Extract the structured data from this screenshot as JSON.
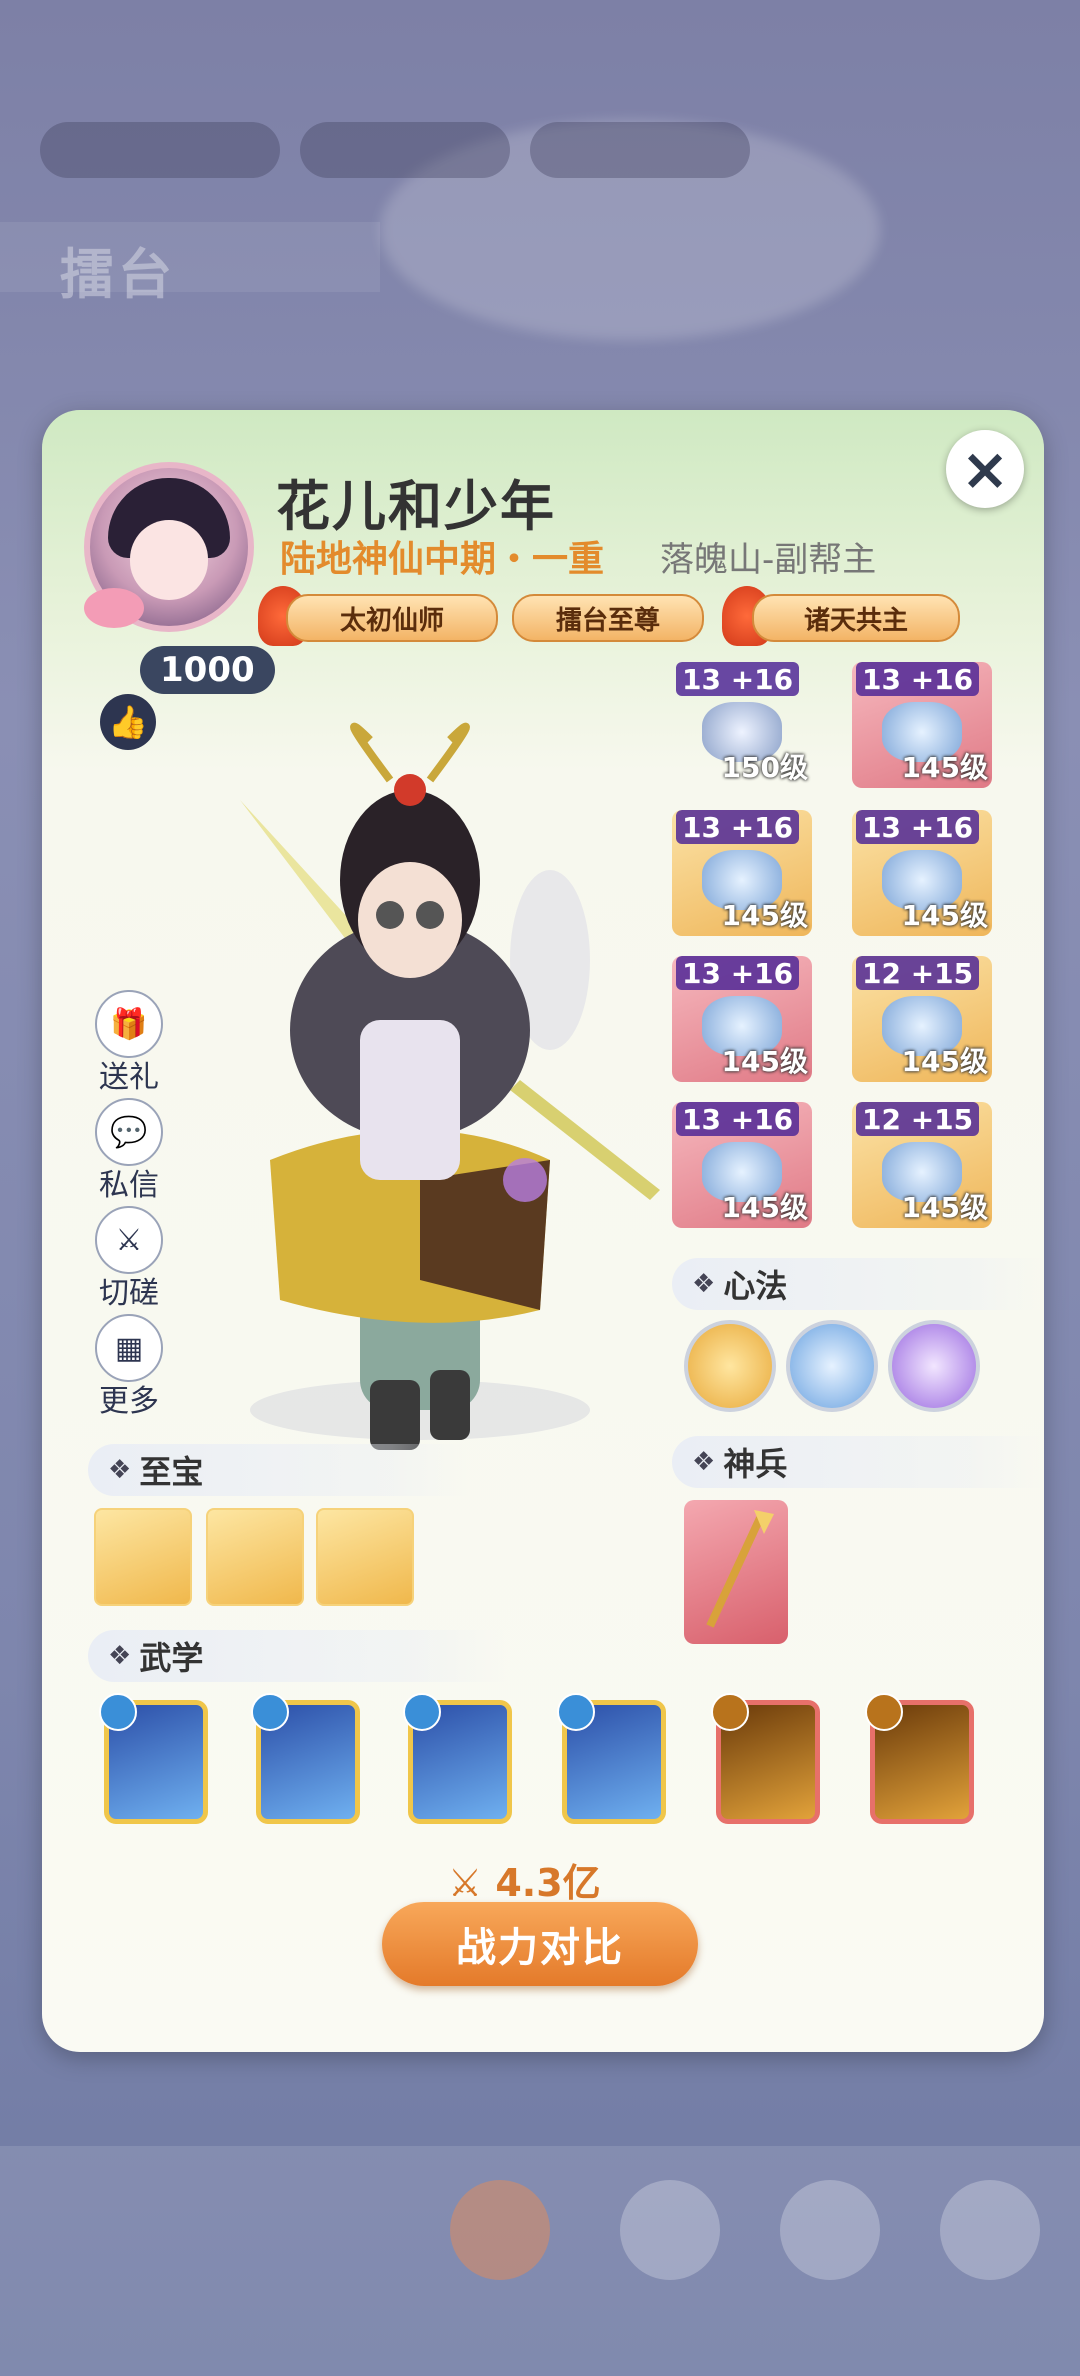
{
  "player": {
    "name": "花儿和少年",
    "realm": "陆地神仙中期・一重",
    "guild": "落魄山-副帮主",
    "likes": "1000"
  },
  "titles": [
    "太初仙师",
    "擂台至尊",
    "诸天共主"
  ],
  "side_actions": [
    "送礼",
    "私信",
    "切磋",
    "更多"
  ],
  "gear": [
    {
      "tier": "13 +16",
      "level": "150级",
      "rarity": "orange"
    },
    {
      "tier": "13 +16",
      "level": "145级",
      "rarity": "pink"
    },
    {
      "tier": "13 +16",
      "level": "145级",
      "rarity": "orange"
    },
    {
      "tier": "13 +16",
      "level": "145级",
      "rarity": "orange"
    },
    {
      "tier": "13 +16",
      "level": "145级",
      "rarity": "pink"
    },
    {
      "tier": "12 +15",
      "level": "145级",
      "rarity": "orange"
    },
    {
      "tier": "13 +16",
      "level": "145级",
      "rarity": "pink"
    },
    {
      "tier": "12 +15",
      "level": "145级",
      "rarity": "orange"
    }
  ],
  "sections": {
    "xinfa": "心法",
    "shenbing": "神兵",
    "zhibao": "至宝",
    "wuxue": "武学"
  },
  "power": "4.3亿",
  "compare_button": "战力对比",
  "close_icon": "×",
  "colors": {
    "realm": "#e38b2c",
    "power": "#d7782a",
    "button": "#e47a2a"
  }
}
